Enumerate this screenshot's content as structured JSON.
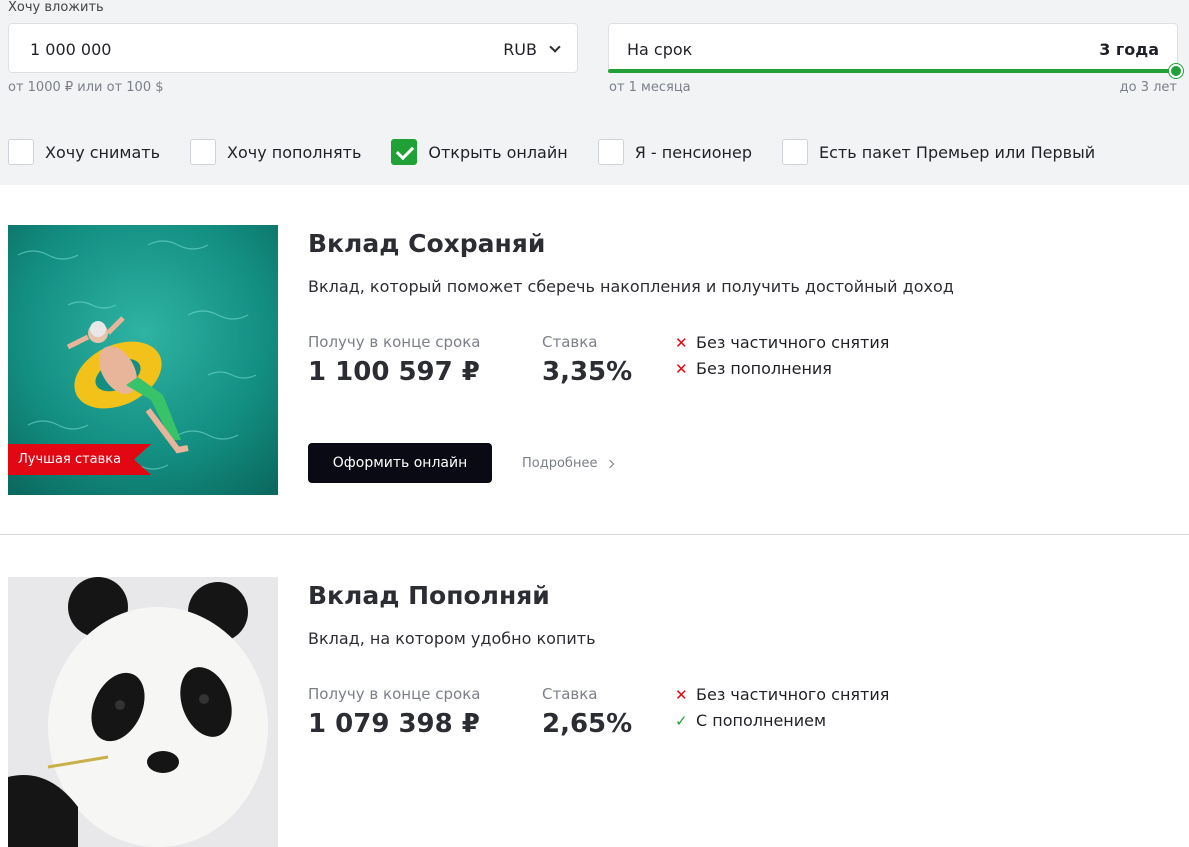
{
  "filters": {
    "amount_label": "Хочу вложить",
    "amount_value": "1 000 000",
    "currency": "RUB",
    "amount_hint": "от 1000 ₽ или от 100 $",
    "term_label": "На срок",
    "term_value": "3 года",
    "term_hint_min": "от 1 месяца",
    "term_hint_max": "до 3 лет",
    "term_slider_fraction": 1.0,
    "checkboxes": [
      {
        "label": "Хочу снимать",
        "checked": false
      },
      {
        "label": "Хочу пополнять",
        "checked": false
      },
      {
        "label": "Открыть онлайн",
        "checked": true
      },
      {
        "label": "Я - пенсионер",
        "checked": false
      },
      {
        "label": "Есть пакет Премьер или Первый",
        "checked": false
      }
    ]
  },
  "deposits": [
    {
      "title": "Вклад Сохраняй",
      "description": "Вклад, который поможет сберечь накопления и получить достойный доход",
      "income_label": "Получу в конце срока",
      "income_value": "1 100 597 ₽",
      "rate_label": "Ставка",
      "rate_value": "3,35%",
      "features": [
        {
          "text": "Без частичного снятия",
          "ok": false
        },
        {
          "text": "Без пополнения",
          "ok": false
        }
      ],
      "badge": "Лучшая ставка",
      "button": "Оформить онлайн",
      "more": "Подробнее"
    },
    {
      "title": "Вклад Пополняй",
      "description": "Вклад, на котором удобно копить",
      "income_label": "Получу в конце срока",
      "income_value": "1 079 398 ₽",
      "rate_label": "Ставка",
      "rate_value": "2,65%",
      "features": [
        {
          "text": "Без частичного снятия",
          "ok": false
        },
        {
          "text": "С пополнением",
          "ok": true
        }
      ]
    }
  ],
  "colors": {
    "accent": "#21a038",
    "badge": "#e30613",
    "button": "#0a0a14",
    "filters_bg": "#f2f3f5"
  },
  "icons": [
    "chevron-down-icon",
    "checkmark-icon",
    "cross-icon",
    "chevron-right-icon"
  ]
}
